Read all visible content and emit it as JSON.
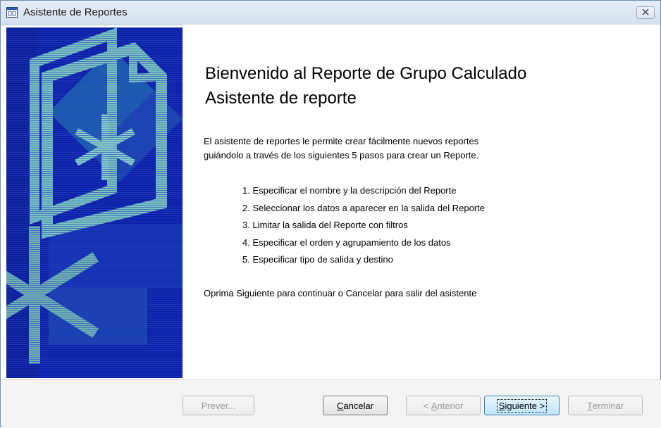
{
  "window": {
    "title": "Asistente de Reportes"
  },
  "content": {
    "heading_line1": "Bienvenido al Reporte de Grupo Calculado",
    "heading_line2": "Asistente de reporte",
    "intro_line1": "El asistente de reportes le permite crear fácilmente nuevos reportes",
    "intro_line2": "guiándolo a través de los siguientes 5 pasos para crear un Reporte.",
    "steps": [
      "1. Especificar el nombre y la descripción del Reporte",
      "2. Seleccionar los datos a aparecer en la salida del Reporte",
      "3. Limitar la salida del Reporte con filtros",
      "4. Especificar el orden y agrupamiento de los datos",
      "5. Especificar tipo de salida y destino"
    ],
    "footer_text": "Oprima Siguiente para continuar o Cancelar para salir del asistente"
  },
  "buttons": {
    "preview": "Prever...",
    "cancel_mnemonic": "C",
    "cancel_rest": "ancelar",
    "back_prefix": "< ",
    "back_mnemonic": "A",
    "back_rest": "nterior",
    "next_mnemonic": "S",
    "next_rest": "iguiente >",
    "finish_mnemonic": "T",
    "finish_rest": "erminar"
  },
  "colors": {
    "sidebar_blue": "#0b22a8",
    "artwork_teal": "#6fb3b0",
    "default_button_border": "#3c7fb1"
  },
  "icons": {
    "app": "report-window-icon",
    "close": "close-icon",
    "sidebar": "report-wizard-artwork"
  }
}
